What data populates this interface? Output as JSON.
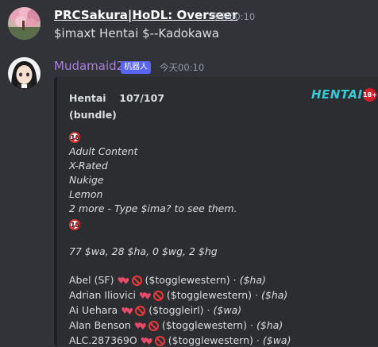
{
  "message1": {
    "username": "PRCSakura|HoDL: Overseer",
    "timestamp": "今天00:10",
    "text": "$imaxt Hentai $--Kadokawa"
  },
  "message2": {
    "username": "Mudamaid2",
    "bot_badge": "机器人",
    "timestamp": "今天00:10",
    "embed": {
      "title": "Hentai",
      "count": "107/107",
      "bundle": "(bundle)",
      "logo_text": "HENTAI",
      "logo_badge": "18+",
      "rating_icon": "no-under-18-icon",
      "tags": [
        "Adult Content",
        "X-Rated",
        "Nukige",
        "Lemon"
      ],
      "more": "2 more - Type $ima? to see them.",
      "stats": "77 $wa, 28 $ha, 0 $wg, 2 $hg",
      "characters": [
        {
          "name": "Abel (SF)",
          "toggle": "($togglewestern)",
          "sep": "·",
          "type": "($ha)"
        },
        {
          "name": "Adrian Iliovici",
          "toggle": "($togglewestern)",
          "sep": "·",
          "type": "($ha)"
        },
        {
          "name": "Ai Uehara",
          "toggle": "($toggleirl)",
          "sep": "·",
          "type": "($wa)"
        },
        {
          "name": "Alan Benson",
          "toggle": "($togglewestern)",
          "sep": "·",
          "type": "($ha)"
        },
        {
          "name": "ALC.287369O",
          "toggle": "($togglewestern)",
          "sep": "·",
          "type": "($wa)"
        }
      ]
    }
  },
  "colors": {
    "background": "#313338",
    "embed_background": "#2b2d31",
    "bot_name": "#a97fdc",
    "bot_badge": "#5865f2",
    "logo": "#35c8d6"
  }
}
